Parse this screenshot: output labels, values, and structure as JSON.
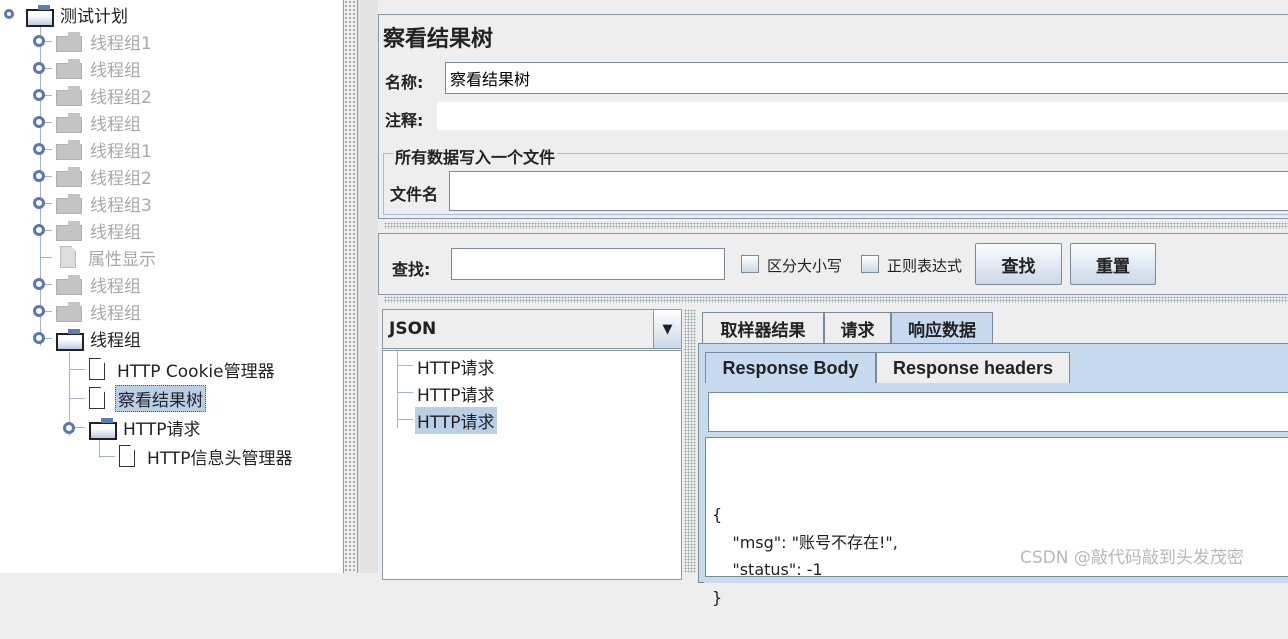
{
  "tree": {
    "root": "测试计划",
    "items": [
      {
        "label": "线程组1",
        "disabled": true
      },
      {
        "label": "线程组",
        "disabled": true
      },
      {
        "label": "线程组2",
        "disabled": true
      },
      {
        "label": "线程组",
        "disabled": true
      },
      {
        "label": "线程组1",
        "disabled": true
      },
      {
        "label": "线程组2",
        "disabled": true
      },
      {
        "label": "线程组3",
        "disabled": true
      },
      {
        "label": "线程组",
        "disabled": true
      },
      {
        "label": "属性显示",
        "disabled": true
      },
      {
        "label": "线程组",
        "disabled": true
      },
      {
        "label": "线程组",
        "disabled": true
      },
      {
        "label": "线程组",
        "disabled": false
      }
    ],
    "children": [
      "HTTP Cookie管理器",
      "察看结果树",
      "HTTP请求"
    ],
    "grandchild": "HTTP信息头管理器"
  },
  "panel": {
    "title": "察看结果树",
    "name_label": "名称:",
    "name_value": "察看结果树",
    "comment_label": "注释:",
    "comment_value": "",
    "file_section": "所有数据写入一个文件",
    "file_label": "文件名",
    "file_value": ""
  },
  "search": {
    "label": "查找:",
    "value": "",
    "case_label": "区分大小写",
    "regex_label": "正则表达式",
    "find_button": "查找",
    "reset_button": "重置"
  },
  "results": {
    "renderer": "JSON",
    "items": [
      "HTTP请求",
      "HTTP请求",
      "HTTP请求"
    ],
    "selected_index": 2
  },
  "tabs": [
    "取样器结果",
    "请求",
    "响应数据"
  ],
  "active_tab": 2,
  "subtabs": [
    "Response Body",
    "Response headers"
  ],
  "active_subtab": 0,
  "response": {
    "lines": [
      "{",
      "    \"msg\": \"账号不存在!\",",
      "    \"status\": -1",
      "}"
    ]
  },
  "watermark": "CSDN @敲代码敲到头发茂密"
}
